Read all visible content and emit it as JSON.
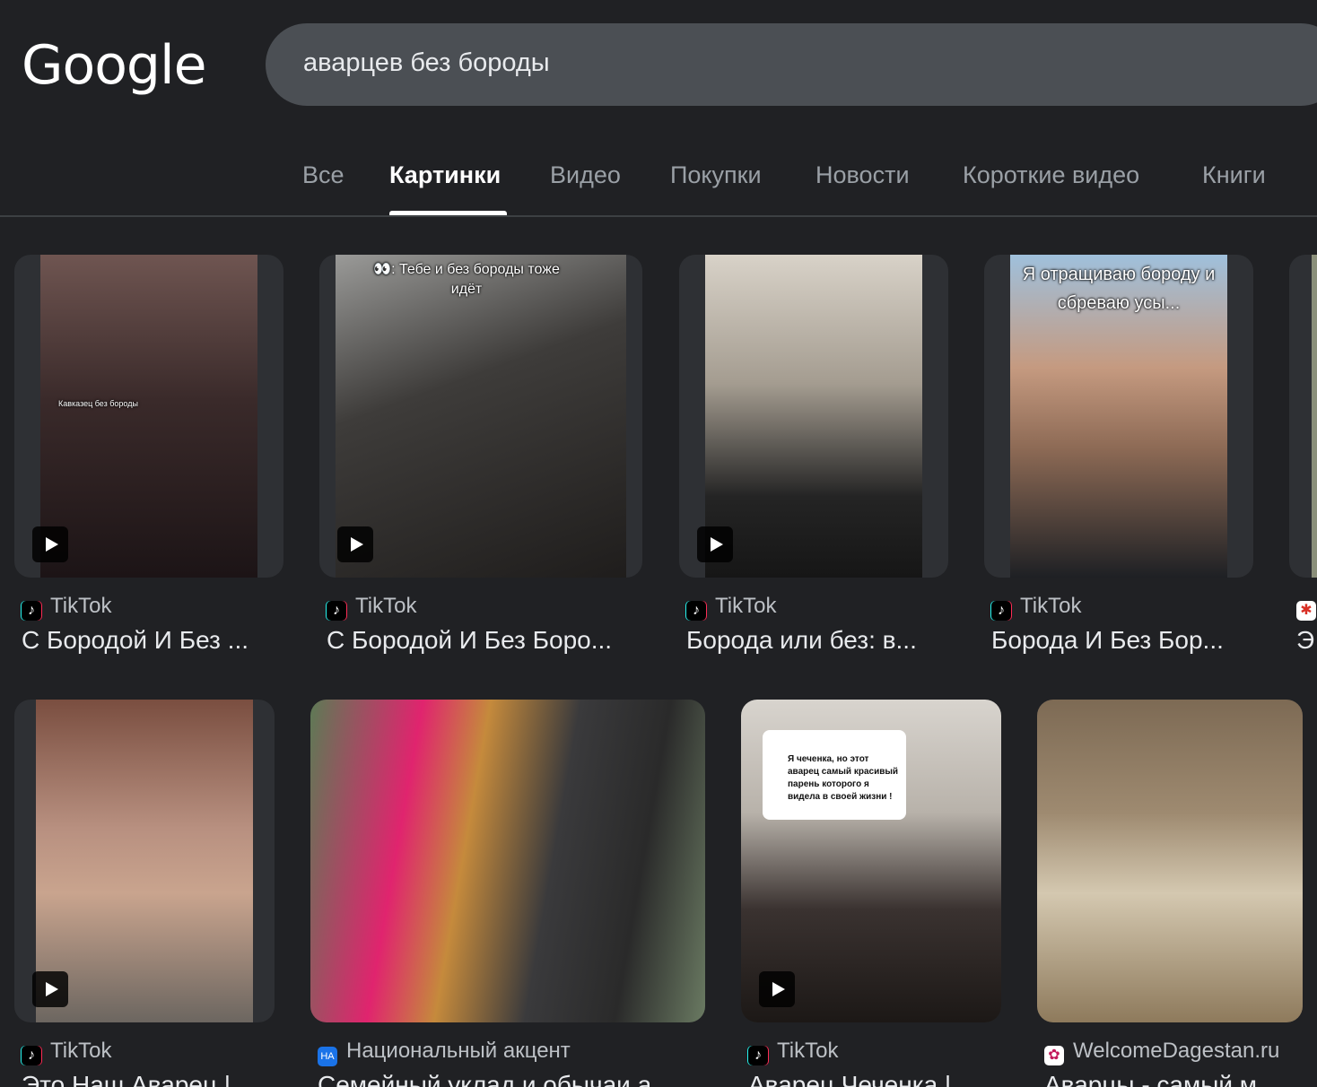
{
  "logo": "Google",
  "search": {
    "query": "аварцев без бороды"
  },
  "tabs": [
    {
      "label": "Все",
      "active": false
    },
    {
      "label": "Картинки",
      "active": true
    },
    {
      "label": "Видео",
      "active": false
    },
    {
      "label": "Покупки",
      "active": false
    },
    {
      "label": "Новости",
      "active": false
    },
    {
      "label": "Короткие видео",
      "active": false
    },
    {
      "label": "Книги",
      "active": false
    }
  ],
  "results": [
    {
      "source": "TikTok",
      "title": "С Бородой И Без ...",
      "video": true,
      "overlay": "Кавказец без бороды"
    },
    {
      "source": "TikTok",
      "title": "С Бородой И Без Боро...",
      "video": true,
      "overlay": "👀: Тебе и без бороды тоже идёт"
    },
    {
      "source": "TikTok",
      "title": "Борода или без: в...",
      "video": true
    },
    {
      "source": "TikTok",
      "title": "Борода И Без Бор...",
      "video": false,
      "overlay": "Я отращиваю бороду и сбреваю усы..."
    },
    {
      "source": "",
      "title": "Э",
      "video": false
    },
    {
      "source": "TikTok",
      "title": "Это Наш Аварец |...",
      "video": true
    },
    {
      "source": "Национальный акцент",
      "title": "Семейный уклад и обычаи а...",
      "video": false
    },
    {
      "source": "TikTok",
      "title": "Аварец Чеченка |...",
      "video": true,
      "overlay": "Я чеченка, но этот аварец самый красивый парень которого я видела в своей жизни !"
    },
    {
      "source": "WelcomeDagestan.ru",
      "title": "Аварцы - самый м...",
      "video": false
    }
  ],
  "colors": {
    "background": "#202124",
    "search_bg": "#4b4f54",
    "tab_inactive": "#9aa0a6",
    "text": "#e8eaed"
  }
}
